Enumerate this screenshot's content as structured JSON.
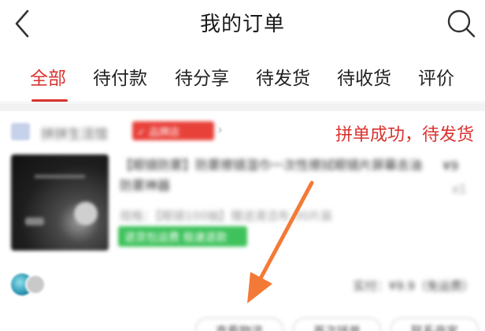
{
  "header": {
    "title": "我的订单",
    "back_icon": "chevron-left-icon",
    "search_icon": "search-icon"
  },
  "tabs": [
    {
      "label": "全部",
      "active": true
    },
    {
      "label": "待付款",
      "active": false
    },
    {
      "label": "待分享",
      "active": false
    },
    {
      "label": "待发货",
      "active": false
    },
    {
      "label": "待收货",
      "active": false
    },
    {
      "label": "评价",
      "active": false
    }
  ],
  "order": {
    "store_name": "拼拼生活馆",
    "store_badge": "✓ 品牌店",
    "status": "拼单成功，待发货",
    "product": {
      "title": "【眼镜防雾】防雾擦镜湿巾一次性擦拭眼镜片屏幕去油防雾神器",
      "price": "¥9",
      "qty": "x1",
      "spec": "规格：【眼镜100抽】赠送清洁布 30片装",
      "tag": "退货包运费 极速退款"
    },
    "paid_text": "实付：¥9.9（免运费）",
    "buttons": [
      "查看物流",
      "再次拼单",
      "联系商家"
    ]
  },
  "colors": {
    "accent": "#d9332f",
    "arrow": "#f37a36",
    "tag_green": "#3fc25c"
  }
}
